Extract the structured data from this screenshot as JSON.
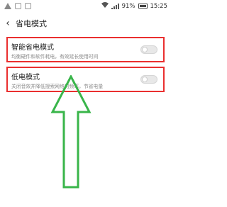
{
  "status_bar": {
    "battery_percent": "91%",
    "time": "15:25"
  },
  "header": {
    "back_icon": "chevron-left",
    "title": "省电模式"
  },
  "settings": [
    {
      "label": "智能省电模式",
      "description": "均衡硬件和软件耗电，有效延长使用时间",
      "enabled": false
    },
    {
      "label": "低电模式",
      "description": "关闭音效并降低搜索网络的频率，节省电量",
      "enabled": false
    }
  ],
  "colors": {
    "highlight_border": "#ea2f2f",
    "arrow": "#39b54a"
  }
}
